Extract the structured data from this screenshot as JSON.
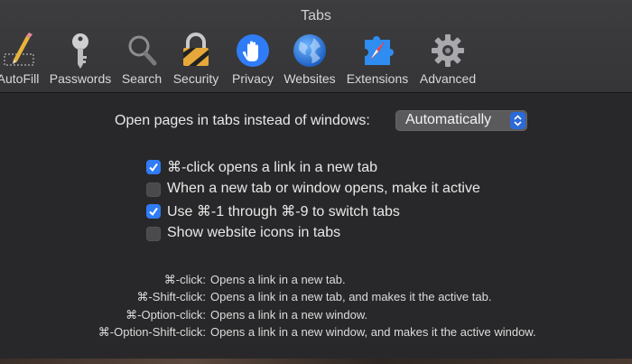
{
  "window": {
    "title": "Tabs"
  },
  "toolbar": {
    "items": [
      {
        "label": "AutoFill",
        "icon": "pencil-icon"
      },
      {
        "label": "Passwords",
        "icon": "key-icon"
      },
      {
        "label": "Search",
        "icon": "magnifier-icon"
      },
      {
        "label": "Security",
        "icon": "padlock-icon"
      },
      {
        "label": "Privacy",
        "icon": "hand-icon"
      },
      {
        "label": "Websites",
        "icon": "globe-icon"
      },
      {
        "label": "Extensions",
        "icon": "puzzle-compass-icon"
      },
      {
        "label": "Advanced",
        "icon": "gear-icon"
      }
    ]
  },
  "open_pages": {
    "label": "Open pages in tabs instead of windows:",
    "selected": "Automatically"
  },
  "options": [
    {
      "label": "⌘-click opens a link in a new tab",
      "checked": true
    },
    {
      "label": "When a new tab or window opens, make it active",
      "checked": false
    },
    {
      "label": "Use ⌘-1 through ⌘-9 to switch tabs",
      "checked": true
    },
    {
      "label": "Show website icons in tabs",
      "checked": false
    }
  ],
  "shortcuts": [
    {
      "key": "⌘-click:",
      "desc": "Opens a link in a new tab."
    },
    {
      "key": "⌘-Shift-click:",
      "desc": "Opens a link in a new tab, and makes it the active tab."
    },
    {
      "key": "⌘-Option-click:",
      "desc": "Opens a link in a new window."
    },
    {
      "key": "⌘-Option-Shift-click:",
      "desc": "Opens a link in a new window, and makes it the active window."
    }
  ],
  "colors": {
    "accent": "#2f7cf6",
    "background": "#28282a",
    "toolbar": "#3a3a3c"
  }
}
